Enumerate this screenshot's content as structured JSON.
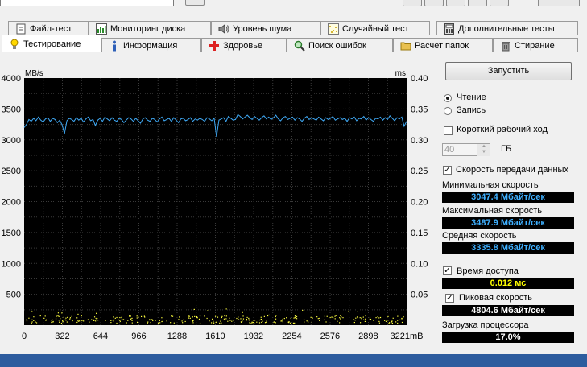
{
  "tabs_row1": [
    {
      "label": "Файл-тест",
      "icon": "document-icon"
    },
    {
      "label": "Мониторинг диска",
      "icon": "bar-chart-icon"
    },
    {
      "label": "Уровень шума",
      "icon": "speaker-icon"
    },
    {
      "label": "Случайный тест",
      "icon": "random-dots-icon"
    },
    {
      "label": "Дополнительные тесты",
      "icon": "calculator-icon"
    }
  ],
  "tabs_row2": [
    {
      "label": "Тестирование",
      "icon": "lightbulb-icon",
      "active": true
    },
    {
      "label": "Информация",
      "icon": "info-icon"
    },
    {
      "label": "Здоровье",
      "icon": "red-cross-icon"
    },
    {
      "label": "Поиск ошибок",
      "icon": "magnifier-icon"
    },
    {
      "label": "Расчет папок",
      "icon": "folder-icon"
    },
    {
      "label": "Стирание",
      "icon": "trash-icon"
    }
  ],
  "chart": {
    "y_left_unit": "MB/s",
    "y_right_unit": "ms",
    "x_unit": "mB",
    "colors": {
      "background": "#000000",
      "grid": "#3a3a3a",
      "transfer": "#3fa9f5",
      "access": "#ffff40",
      "axis_label": "#ffffff"
    }
  },
  "chart_data": {
    "type": "line",
    "x_axis": {
      "ticks": [
        0,
        322,
        644,
        966,
        1288,
        1610,
        1932,
        2254,
        2576,
        2898,
        3221
      ],
      "unit": "mB",
      "range": [
        0,
        3221
      ]
    },
    "y_left_axis": {
      "ticks": [
        500,
        1000,
        1500,
        2000,
        2500,
        3000,
        3500,
        4000
      ],
      "unit": "MB/s",
      "range": [
        0,
        4000
      ]
    },
    "y_right_axis": {
      "ticks": [
        "0.05",
        "0.10",
        "0.15",
        "0.20",
        "0.25",
        "0.30",
        "0.35",
        "0.40"
      ],
      "unit": "ms",
      "range": [
        0,
        0.4
      ]
    },
    "grid": true,
    "series": [
      {
        "color": "#3fa9f5",
        "axis": "left",
        "x": [
          0,
          20,
          40,
          60,
          80,
          100,
          120,
          140,
          160,
          180,
          200,
          220,
          240,
          260,
          280,
          300,
          320,
          340,
          360,
          380,
          400,
          420,
          440,
          460,
          480,
          500,
          520,
          540,
          560,
          580,
          600,
          620,
          640,
          660,
          680,
          700,
          720,
          740,
          760,
          780,
          800,
          820,
          840,
          860,
          880,
          900,
          920,
          940,
          960,
          980,
          1000,
          1020,
          1040,
          1060,
          1080,
          1100,
          1120,
          1140,
          1160,
          1180,
          1200,
          1220,
          1240,
          1260,
          1280,
          1300,
          1320,
          1340,
          1360,
          1380,
          1400,
          1420,
          1440,
          1460,
          1480,
          1500,
          1520,
          1540,
          1560,
          1580,
          1600,
          1620,
          1640,
          1660,
          1680,
          1700,
          1720,
          1740,
          1760,
          1780,
          1800,
          1820,
          1840,
          1860,
          1880,
          1900,
          1920,
          1940,
          1960,
          1980,
          2000,
          2020,
          2040,
          2060,
          2080,
          2100,
          2120,
          2140,
          2160,
          2180,
          2200,
          2220,
          2240,
          2260,
          2280,
          2300,
          2320,
          2340,
          2360,
          2380,
          2400,
          2420,
          2440,
          2460,
          2480,
          2500,
          2520,
          2540,
          2560,
          2580,
          2600,
          2620,
          2640,
          2660,
          2680,
          2700,
          2720,
          2740,
          2760,
          2780,
          2800,
          2820,
          2840,
          2860,
          2880,
          2900,
          2920,
          2940,
          2960,
          2980,
          3000,
          3020,
          3040,
          3060,
          3080,
          3100,
          3120,
          3140,
          3160,
          3180,
          3200,
          3221
        ],
        "values": [
          3200,
          3250,
          3330,
          3300,
          3350,
          3310,
          3370,
          3320,
          3290,
          3340,
          3360,
          3300,
          3350,
          3330,
          3280,
          3320,
          3240,
          3100,
          3310,
          3350,
          3330,
          3300,
          3360,
          3320,
          3350,
          3290,
          3340,
          3370,
          3310,
          3330,
          3230,
          3320,
          3350,
          3300,
          3370,
          3340,
          3310,
          3360,
          3320,
          3300,
          3350,
          3330,
          3280,
          3320,
          3360,
          3340,
          3300,
          3350,
          3310,
          3270,
          3340,
          3360,
          3320,
          3300,
          3350,
          3330,
          3290,
          3340,
          3370,
          3310,
          3330,
          3350,
          3300,
          3360,
          3320,
          3280,
          3340,
          3350,
          3310,
          3330,
          3360,
          3300,
          3340,
          3320,
          3350,
          3330,
          3300,
          3360,
          3340,
          3310,
          3350,
          3050,
          3320,
          3340,
          3360,
          3300,
          3380,
          3350,
          3320,
          3330,
          3410,
          3380,
          3340,
          3370,
          3400,
          3360,
          3330,
          3380,
          3350,
          3320,
          3360,
          3390,
          3340,
          3370,
          3330,
          3360,
          3400,
          3340,
          3310,
          3360,
          3380,
          3330,
          3350,
          3370,
          3320,
          3360,
          3340,
          3300,
          3350,
          3380,
          3330,
          3360,
          3340,
          3320,
          3370,
          3340,
          3310,
          3360,
          3330,
          3350,
          3380,
          3320,
          3340,
          3360,
          3330,
          3350,
          3300,
          3360,
          3340,
          3370,
          3310,
          3350,
          3340,
          3380,
          3320,
          3360,
          3330,
          3300,
          3350,
          3340,
          3370,
          3320,
          3360,
          3330,
          3390,
          3350,
          3310,
          3360,
          3340,
          3370,
          3220,
          3300
        ]
      }
    ]
  },
  "controls": {
    "start_button": "Запустить",
    "radio_read": "Чтение",
    "radio_write": "Запись",
    "short_stroke": "Короткий рабочий ход",
    "spin_value": "40",
    "spin_unit": "ГБ",
    "transfer_rate": "Скорость передачи данных",
    "min_label": "Минимальная скорость",
    "min_value": "3047.4 Мбайт/сек",
    "max_label": "Максимальная скорость",
    "max_value": "3487.9 Мбайт/сек",
    "avg_label": "Средняя скорость",
    "avg_value": "3335.8 Мбайт/сек",
    "access_label": "Время доступа",
    "access_value": "0.012 мс",
    "burst_label": "Пиковая скорость",
    "burst_value": "4804.6 Мбайт/сек",
    "cpu_label": "Загрузка процессора",
    "cpu_value": "17.0%",
    "read_selected": true,
    "short_stroke_checked": false,
    "transfer_checked": true,
    "access_checked": true,
    "burst_checked": true
  }
}
